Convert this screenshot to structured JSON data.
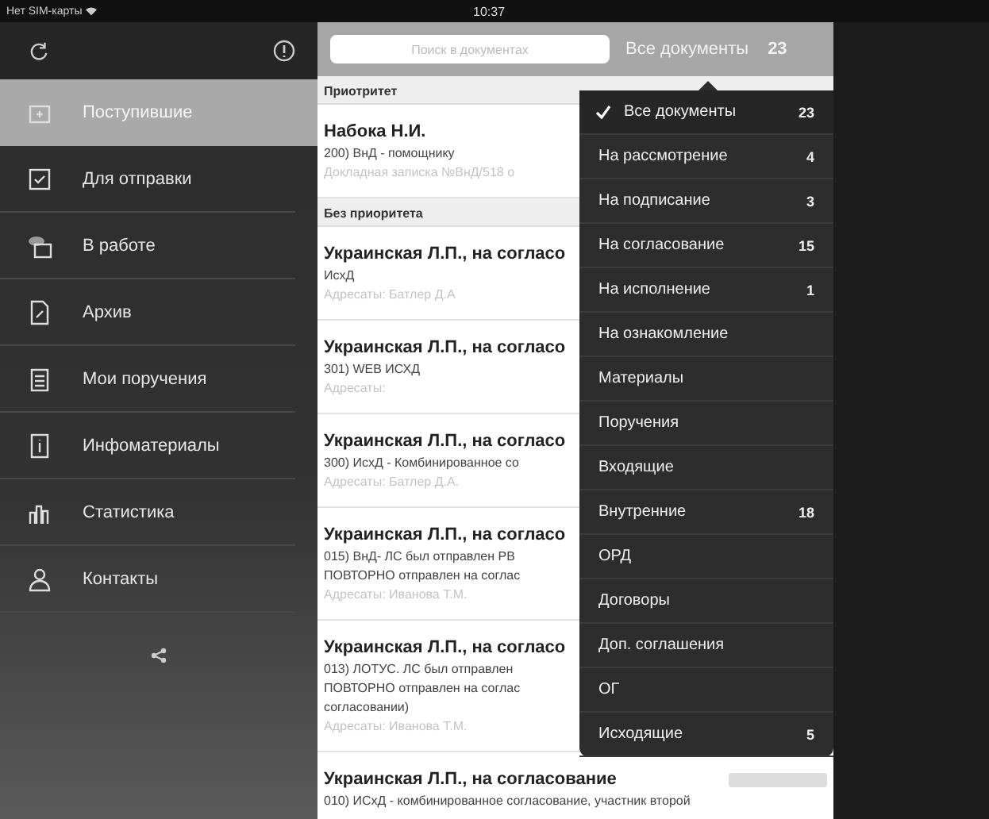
{
  "status_bar": {
    "carrier": "Нет SIM-карты",
    "time": "10:37"
  },
  "sidebar": {
    "items": [
      {
        "label": "Поступившие",
        "selected": true
      },
      {
        "label": "Для отправки",
        "selected": false
      },
      {
        "label": "В работе",
        "selected": false
      },
      {
        "label": "Архив",
        "selected": false
      },
      {
        "label": "Мои поручения",
        "selected": false
      },
      {
        "label": "Инфоматериалы",
        "selected": false
      },
      {
        "label": "Статистика",
        "selected": false
      },
      {
        "label": "Контакты",
        "selected": false
      }
    ]
  },
  "list": {
    "search": {
      "placeholder": "Поиск в документах"
    },
    "filter": {
      "label": "Все документы",
      "count": "23"
    },
    "sections": [
      {
        "title": "Приотритет",
        "rows": [
          {
            "title": "Набока Н.И.",
            "lines": [
              "200) ВнД - помощнику"
            ],
            "note": "Докладная записка №ВнД/518 о"
          }
        ]
      },
      {
        "title": "Без приоритета",
        "rows": [
          {
            "title": "Украинская Л.П., на согласо",
            "lines": [
              "ИсхД"
            ],
            "note": "Адресаты: Батлер Д.А"
          },
          {
            "title": "Украинская Л.П., на согласо",
            "lines": [
              "301) WEB ИСХД"
            ],
            "note": "Адресаты:"
          },
          {
            "title": "Украинская Л.П., на согласо",
            "lines": [
              "300) ИсхД - Комбинированное со"
            ],
            "note": "Адресаты: Батлер Д.А."
          },
          {
            "title": "Украинская Л.П., на согласо",
            "lines": [
              "015) ВнД- ЛС был отправлен РВ",
              "ПОВТОРНО отправлен на соглас"
            ],
            "note": "Адресаты: Иванова Т.М."
          },
          {
            "title": "Украинская Л.П., на согласо",
            "lines": [
              "013) ЛОТУС. ЛС был отправлен",
              "ПОВТОРНО отправлен на соглас",
              "согласовании)"
            ],
            "note": "Адресаты: Иванова Т.М."
          },
          {
            "title": "Украинская Л.П., на согласование",
            "lines": [
              "010) ИСхД - комбинированное согласование, участник второй"
            ]
          }
        ]
      }
    ]
  },
  "menu": {
    "items": [
      {
        "label": "Все документы",
        "count": "23",
        "selected": true
      },
      {
        "label": "На рассмотрение",
        "count": "4",
        "selected": false
      },
      {
        "label": "На подписание",
        "count": "3",
        "selected": false
      },
      {
        "label": "На согласование",
        "count": "15",
        "selected": false
      },
      {
        "label": "На исполнение",
        "count": "1",
        "selected": false
      },
      {
        "label": "На ознакомление",
        "selected": false
      },
      {
        "label": "Материалы",
        "selected": false
      },
      {
        "label": "Поручения",
        "selected": false
      },
      {
        "label": "Входящие",
        "selected": false
      },
      {
        "label": "Внутренние",
        "count": "18",
        "selected": false
      },
      {
        "label": "ОРД",
        "selected": false
      },
      {
        "label": "Договоры",
        "selected": false
      },
      {
        "label": "Доп. соглашения",
        "selected": false
      },
      {
        "label": "ОГ",
        "selected": false
      },
      {
        "label": "Исходящие",
        "count": "5",
        "selected": false
      }
    ]
  }
}
